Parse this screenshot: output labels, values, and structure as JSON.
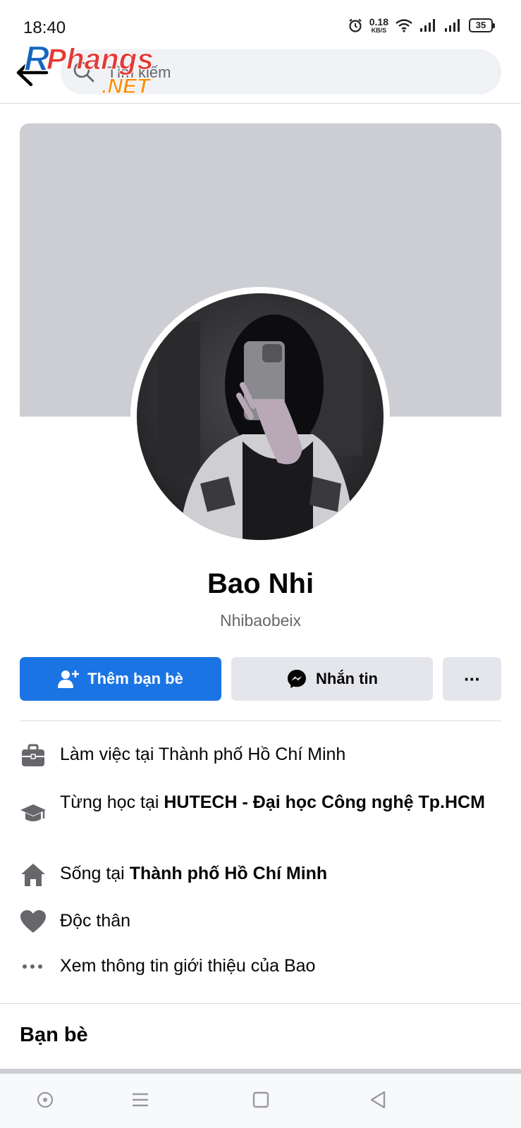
{
  "status_bar": {
    "time": "18:40",
    "net_speed_value": "0.18",
    "net_speed_unit": "KB/S",
    "battery": "35",
    "icons": [
      "alarm-icon",
      "wifi-icon",
      "signal-icon",
      "signal-icon",
      "battery-icon"
    ]
  },
  "header": {
    "search_placeholder": "Tìm kiếm",
    "watermark": {
      "line1": "Phangs",
      "line2": ".NET",
      "initial": "R"
    }
  },
  "profile": {
    "name": "Bao Nhi",
    "username": "Nhibaobeix"
  },
  "actions": {
    "add_friend": "Thêm bạn bè",
    "message": "Nhắn tin",
    "more": "···"
  },
  "intro": {
    "work": {
      "prefix": "Làm việc tại Thành phố Hồ Chí Minh"
    },
    "education": {
      "prefix": "Từng học tại ",
      "bold": "HUTECH - Đại học Công nghệ Tp.HCM"
    },
    "location": {
      "prefix": "Sống tại ",
      "bold": "Thành phố Hồ Chí Minh"
    },
    "relationship": {
      "prefix": "Độc thân"
    },
    "see_more": {
      "prefix": "Xem thông tin giới thiệu của Bao"
    }
  },
  "friends": {
    "heading": "Bạn bè"
  },
  "colors": {
    "accent": "#1b74e4",
    "secondary_button": "#e4e6eb",
    "cover": "#ccced3",
    "muted_text": "#65676b"
  }
}
